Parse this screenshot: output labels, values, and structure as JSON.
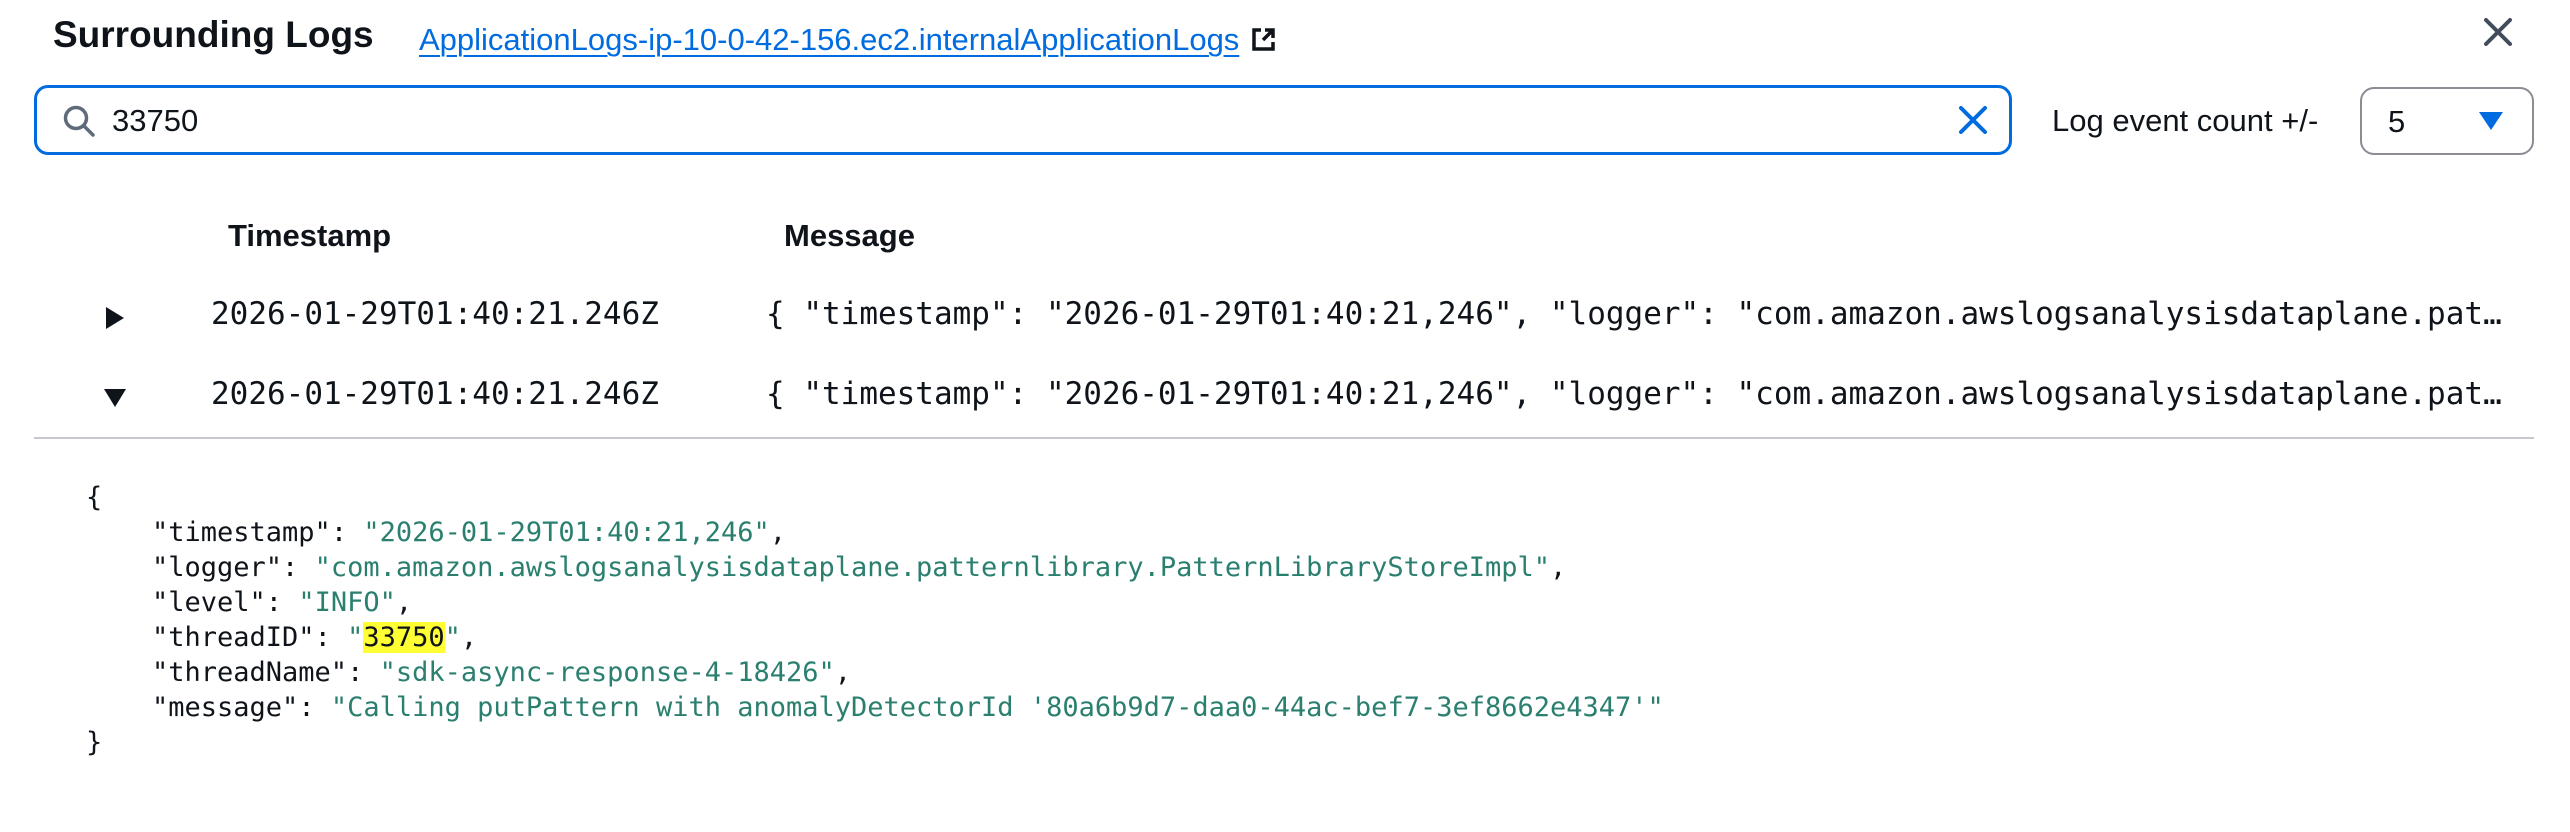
{
  "header": {
    "title": "Surrounding Logs",
    "log_link": "ApplicationLogs-ip-10-0-42-156.ec2.internalApplicationLogs"
  },
  "search": {
    "value": "33750",
    "placeholder": ""
  },
  "count": {
    "label": "Log event count +/-",
    "value": "5"
  },
  "table": {
    "headers": {
      "timestamp": "Timestamp",
      "message": "Message"
    },
    "rows": [
      {
        "timestamp": "2026-01-29T01:40:21.246Z",
        "message": "{ \"timestamp\": \"2026-01-29T01:40:21,246\", \"logger\": \"com.amazon.awslogsanalysisdataplane.patt…",
        "expanded": false
      },
      {
        "timestamp": "2026-01-29T01:40:21.246Z",
        "message": "{ \"timestamp\": \"2026-01-29T01:40:21,246\", \"logger\": \"com.amazon.awslogsanalysisdataplane.patt…",
        "expanded": true
      }
    ]
  },
  "expanded_json": {
    "open": "{",
    "close": "}",
    "fields": [
      {
        "key": "\"timestamp\"",
        "value": "2026-01-29T01:40:21,246"
      },
      {
        "key": "\"logger\"",
        "value": "com.amazon.awslogsanalysisdataplane.patternlibrary.PatternLibraryStoreImpl"
      },
      {
        "key": "\"level\"",
        "value": "INFO"
      },
      {
        "key": "\"threadID\"",
        "value": "33750",
        "highlight": true
      },
      {
        "key": "\"threadName\"",
        "value": "sdk-async-response-4-18426"
      },
      {
        "key": "\"message\"",
        "value": "Calling putPattern with anomalyDetectorId '80a6b9d7-daa0-44ac-bef7-3ef8662e4347'"
      }
    ]
  },
  "colors": {
    "link": "#006ce0",
    "json_string": "#2a7f6f",
    "highlight": "#ffff33",
    "focus_border": "#006ce0"
  },
  "icons": {
    "close": "close-icon",
    "external": "external-link-icon",
    "search": "search-icon",
    "clear": "clear-icon",
    "caret_down": "caret-down-icon",
    "caret_right": "caret-right-icon"
  }
}
